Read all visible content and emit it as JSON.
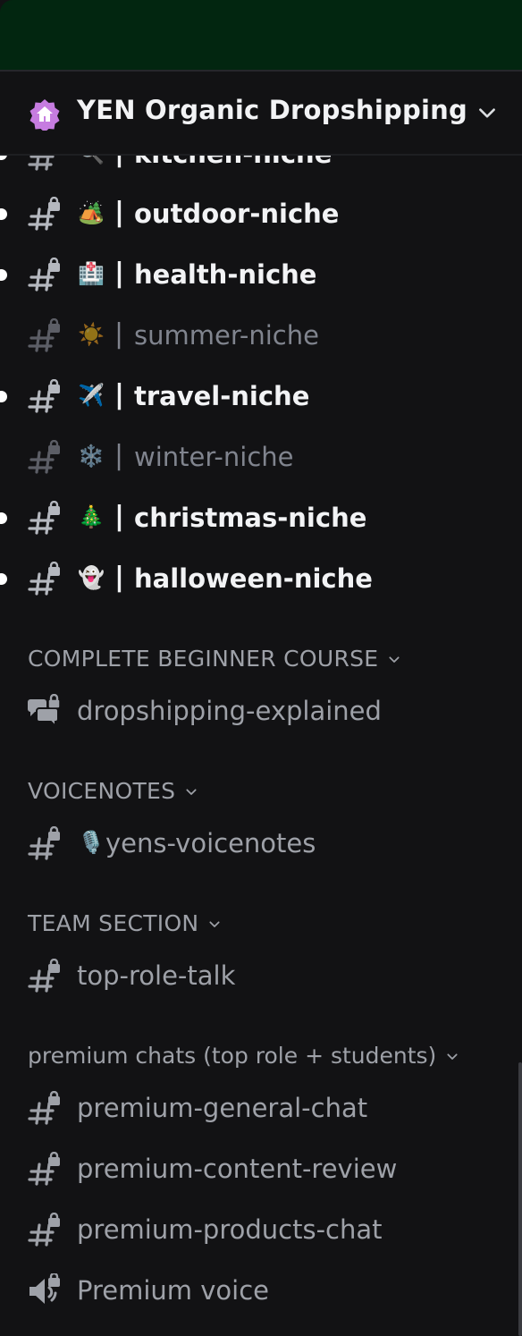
{
  "server": {
    "name": "YEN Organic Dropshipping",
    "icon": "server-boost-house-icon",
    "icon_color": "#c67ce0"
  },
  "colors": {
    "background": "#121214",
    "top_bar": "#022610",
    "text_unread": "#f2f3f5",
    "text_muted": "#80848e",
    "text_normal": "#9ea1a8"
  },
  "niche_channels": [
    {
      "emoji": "🔍",
      "separator": "|",
      "name": "kitchen-niche",
      "state": "unread"
    },
    {
      "emoji": "🏕️",
      "separator": "|",
      "name": "outdoor-niche",
      "state": "unread"
    },
    {
      "emoji": "🏥",
      "separator": "|",
      "name": "health-niche",
      "state": "unread"
    },
    {
      "emoji": "☀️",
      "separator": "|",
      "name": "summer-niche",
      "state": "muted"
    },
    {
      "emoji": "✈️",
      "separator": "|",
      "name": "travel-niche",
      "state": "unread"
    },
    {
      "emoji": "❄️",
      "separator": "|",
      "name": "winter-niche",
      "state": "muted"
    },
    {
      "emoji": "🎄",
      "separator": "|",
      "name": "christmas-niche",
      "state": "unread"
    },
    {
      "emoji": "👻",
      "separator": "|",
      "name": "halloween-niche",
      "state": "unread"
    }
  ],
  "categories": [
    {
      "label": "COMPLETE BEGINNER COURSE",
      "channels": [
        {
          "icon": "locked-forum-icon",
          "name": "dropshipping-explained"
        }
      ]
    },
    {
      "label": "VOICENOTES",
      "channels": [
        {
          "icon": "locked-text-channel-icon",
          "emoji": "🎙️",
          "name": "yens-voicenotes"
        }
      ]
    },
    {
      "label": "TEAM SECTION",
      "channels": [
        {
          "icon": "locked-text-channel-icon",
          "name": "top-role-talk"
        }
      ]
    },
    {
      "label": "premium chats (top role + students)",
      "channels": [
        {
          "icon": "locked-text-channel-icon",
          "name": "premium-general-chat"
        },
        {
          "icon": "locked-text-channel-icon",
          "name": "premium-content-review"
        },
        {
          "icon": "locked-text-channel-icon",
          "name": "premium-products-chat"
        },
        {
          "icon": "locked-voice-channel-icon",
          "name": "Premium voice"
        }
      ]
    }
  ]
}
